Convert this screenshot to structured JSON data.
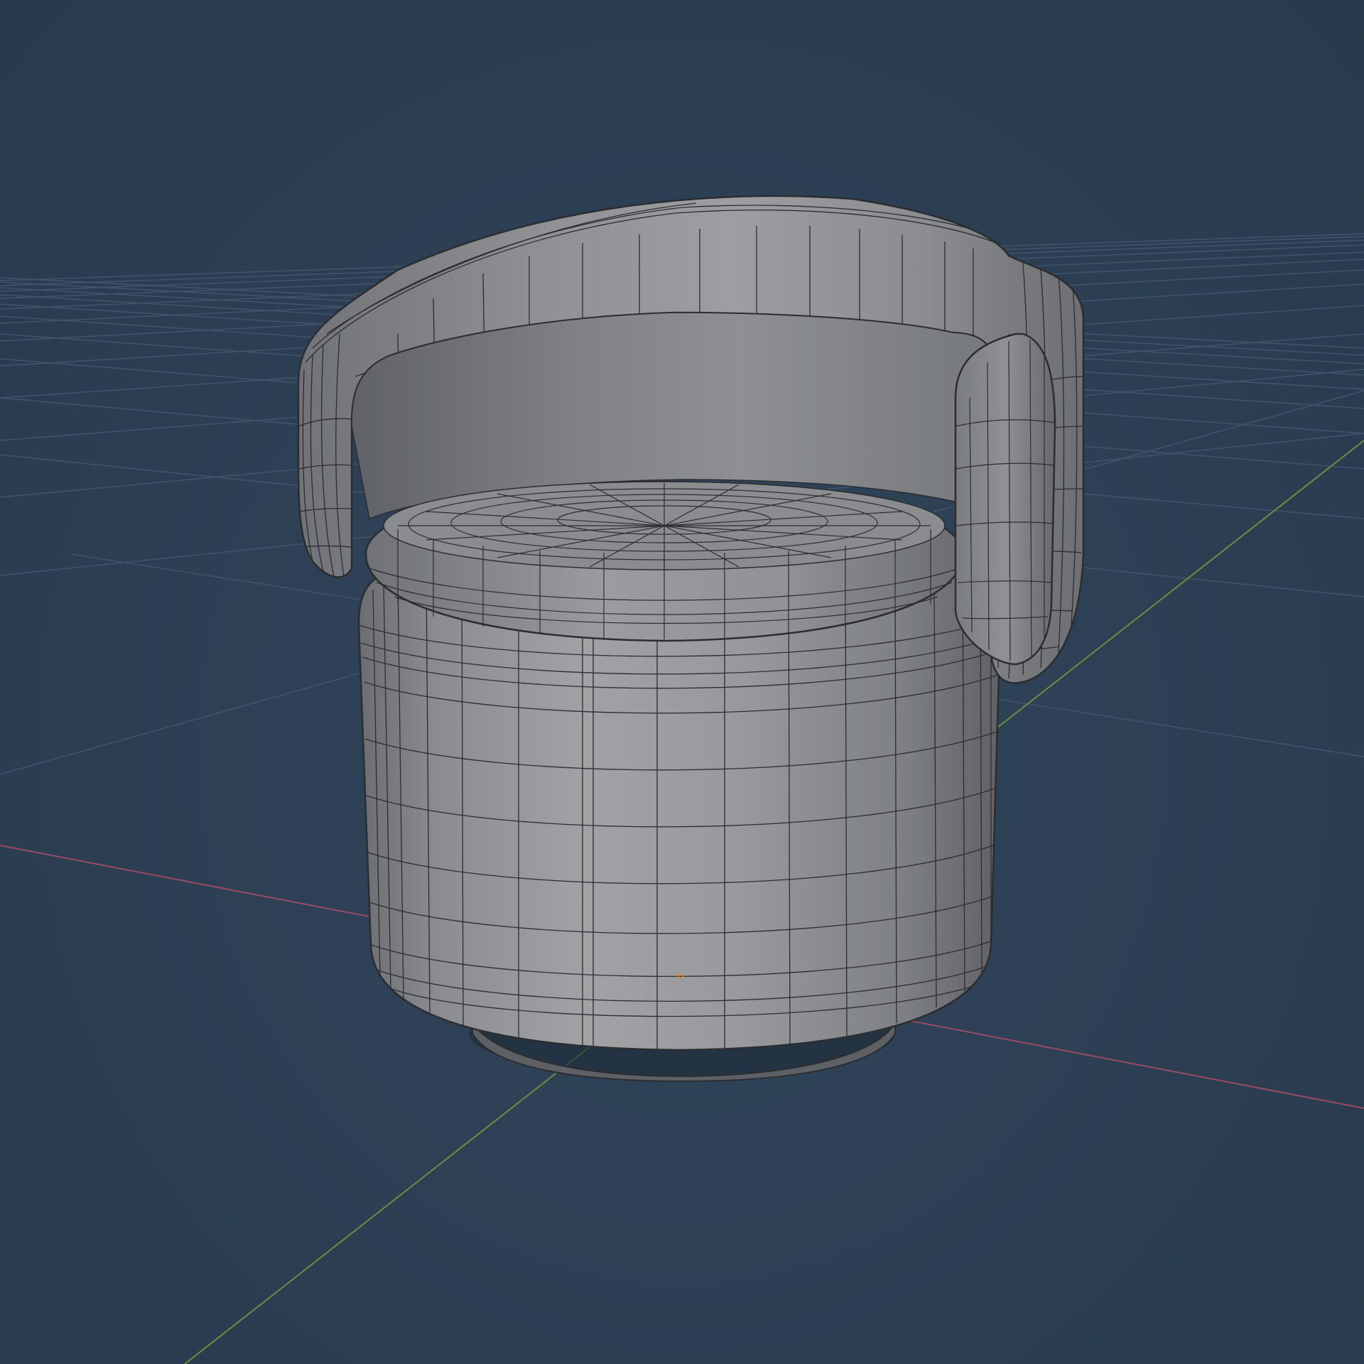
{
  "viewport": {
    "mode": "3d-viewport",
    "shading": "solid",
    "overlays": {
      "wireframe": true,
      "floor_grid": true,
      "x_axis": true,
      "y_axis": true,
      "origin_point": true
    },
    "object": {
      "kind": "swivel-tub-armchair-mesh",
      "parts": [
        "backrest",
        "seat-cushion",
        "base-drum",
        "plinth"
      ]
    },
    "colors": {
      "background": "#2e4054",
      "grid_line": "#45596e",
      "x_axis": "#9a4a62",
      "y_axis": "#6f8c3e",
      "mesh_base": "#8c8e90",
      "mesh_highlight": "#a4a6a8",
      "mesh_shadow": "#5d6064",
      "wire": "#2b2d30",
      "origin": "#e08a2a"
    }
  }
}
